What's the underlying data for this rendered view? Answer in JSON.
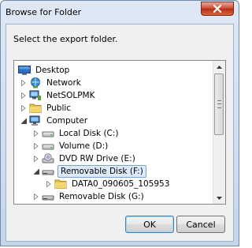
{
  "window": {
    "title": "Browse for Folder",
    "close_glyph": "X"
  },
  "dialog": {
    "prompt": "Select the export folder."
  },
  "tree": {
    "items": [
      {
        "label": "Desktop",
        "icon": "desktop-icon",
        "expander": "none",
        "indent": 0,
        "selected": false
      },
      {
        "label": "Network",
        "icon": "network-icon",
        "expander": "collapsed",
        "indent": 1,
        "selected": false
      },
      {
        "label": "NetSOLPMK",
        "icon": "network-computer-icon",
        "expander": "collapsed",
        "indent": 1,
        "selected": false
      },
      {
        "label": "Public",
        "icon": "folder-icon",
        "expander": "collapsed",
        "indent": 1,
        "selected": false
      },
      {
        "label": "Computer",
        "icon": "computer-icon",
        "expander": "expanded",
        "indent": 1,
        "selected": false
      },
      {
        "label": "Local Disk (C:)",
        "icon": "hard-drive-icon",
        "expander": "collapsed",
        "indent": 2,
        "selected": false
      },
      {
        "label": "Volume (D:)",
        "icon": "hard-drive-icon",
        "expander": "collapsed",
        "indent": 2,
        "selected": false
      },
      {
        "label": "DVD RW Drive (E:)",
        "icon": "dvd-drive-icon",
        "expander": "collapsed",
        "indent": 2,
        "selected": false
      },
      {
        "label": "Removable Disk (F:)",
        "icon": "removable-disk-icon",
        "expander": "expanded",
        "indent": 2,
        "selected": true
      },
      {
        "label": "DATA0_090605_105953",
        "icon": "folder-icon",
        "expander": "collapsed",
        "indent": 3,
        "selected": false
      },
      {
        "label": "Removable Disk (G:)",
        "icon": "removable-disk-icon",
        "expander": "collapsed",
        "indent": 2,
        "selected": false
      }
    ]
  },
  "buttons": {
    "ok": "OK",
    "cancel": "Cancel"
  },
  "colors": {
    "title_bar": "#dfe9f5",
    "close_button": "#c9462e",
    "selection": "#dcebfc",
    "selection_border": "#7da2ce"
  }
}
